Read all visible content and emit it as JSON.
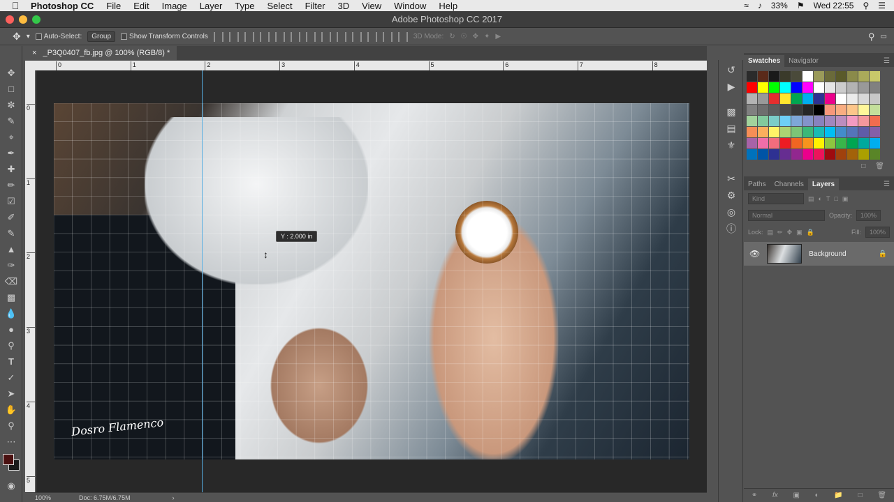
{
  "menubar": {
    "app": "Photoshop CC",
    "items": [
      "File",
      "Edit",
      "Image",
      "Layer",
      "Type",
      "Select",
      "Filter",
      "3D",
      "View",
      "Window",
      "Help"
    ],
    "battery": "33%",
    "clock": "Wed 22:55"
  },
  "window": {
    "title": "Adobe Photoshop CC 2017"
  },
  "options": {
    "auto_select_label": "Auto-Select:",
    "auto_select_value": "Group",
    "transform_label": "Show Transform Controls",
    "mode3d_label": "3D Mode:"
  },
  "document": {
    "tab_title": "_P3Q0407_fb.jpg @ 100% (RGB/8) *",
    "tooltip": "Y : 2.000 in",
    "signature": "Dosro Flamenco"
  },
  "ruler": {
    "top": [
      "0",
      "1",
      "2",
      "3",
      "4",
      "5",
      "6",
      "7",
      "8"
    ],
    "left": [
      "0",
      "1",
      "2",
      "3",
      "4",
      "5"
    ]
  },
  "status": {
    "zoom": "100%",
    "doc": "Doc: 6.75M/6.75M"
  },
  "panels": {
    "swatches_tab": "Swatches",
    "navigator_tab": "Navigator",
    "paths_tab": "Paths",
    "channels_tab": "Channels",
    "layers_tab": "Layers",
    "kind_placeholder": "Kind",
    "blend_mode": "Normal",
    "opacity_label": "Opacity:",
    "opacity_value": "100%",
    "lock_label": "Lock:",
    "fill_label": "Fill:",
    "fill_value": "100%",
    "layer_name": "Background"
  },
  "swatch_colors": [
    "#2b2b2b",
    "#5a2a1a",
    "#1a1a1a",
    "#3a3a2a",
    "#4a4a3a",
    "#ffffff",
    "#9a9a5a",
    "#6a6a3a",
    "#5a5a2a",
    "#8a8a4a",
    "#aaaa5a",
    "#c8c86a",
    "#ff0000",
    "#ffff00",
    "#00ff00",
    "#00ffff",
    "#0000ff",
    "#ff00ff",
    "#ffffff",
    "#e6e6e6",
    "#cccccc",
    "#b3b3b3",
    "#999999",
    "#808080",
    "#b3b3b3",
    "#999999",
    "#e62e2e",
    "#ffe62e",
    "#00a650",
    "#00aeef",
    "#2e3192",
    "#ec008c",
    "#ffffff",
    "#ebebeb",
    "#d9d9d9",
    "#c7c7c7",
    "#808080",
    "#6e6e6e",
    "#5c5c5c",
    "#4a4a4a",
    "#383838",
    "#262626",
    "#000000",
    "#f7977a",
    "#f9ad81",
    "#fdc68a",
    "#fff79a",
    "#c4df9b",
    "#a2d39c",
    "#82ca9d",
    "#7bcdc8",
    "#6ecff6",
    "#7ea7d8",
    "#8493ca",
    "#8882be",
    "#a187be",
    "#bc8dbf",
    "#f49ac2",
    "#f6989d",
    "#f26c4f",
    "#f68e56",
    "#fbaf5d",
    "#fff467",
    "#acd373",
    "#7cc576",
    "#3bb878",
    "#1abbb4",
    "#00bff3",
    "#438cca",
    "#5574b9",
    "#605ca8",
    "#855fa8",
    "#a763a8",
    "#f06ea9",
    "#f26d7d",
    "#ed1c24",
    "#f26522",
    "#f7941d",
    "#fff200",
    "#8dc63f",
    "#39b54a",
    "#00a651",
    "#00a99d",
    "#00aeef",
    "#0072bc",
    "#0054a6",
    "#2e3192",
    "#662d91",
    "#92278f",
    "#ec008c",
    "#ed145b",
    "#9e0b0f",
    "#a0410d",
    "#a36209",
    "#aba000",
    "#598527"
  ]
}
